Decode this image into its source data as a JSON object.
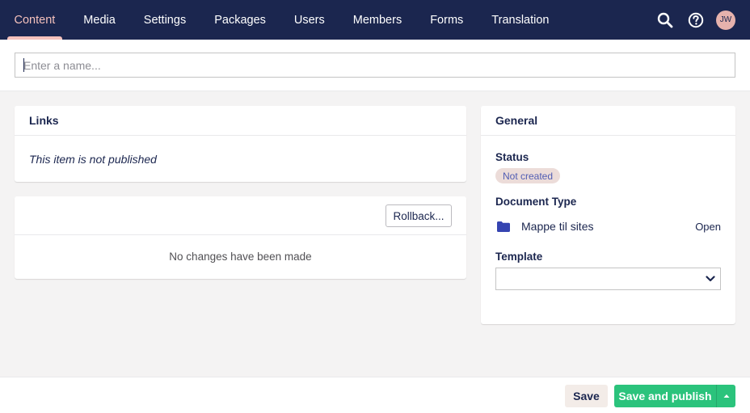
{
  "nav": {
    "items": [
      {
        "label": "Content",
        "active": true
      },
      {
        "label": "Media"
      },
      {
        "label": "Settings"
      },
      {
        "label": "Packages"
      },
      {
        "label": "Users"
      },
      {
        "label": "Members"
      },
      {
        "label": "Forms"
      },
      {
        "label": "Translation"
      }
    ],
    "icons": [
      "search-icon",
      "help-icon"
    ],
    "avatar_initials": "JW"
  },
  "name_field": {
    "placeholder": "Enter a name...",
    "value": ""
  },
  "links_panel": {
    "title": "Links",
    "message": "This item is not published"
  },
  "history_panel": {
    "rollback_label": "Rollback...",
    "message": "No changes have been made"
  },
  "general_panel": {
    "title": "General",
    "status_label": "Status",
    "status_value": "Not created",
    "doc_type_label": "Document Type",
    "doc_type_icon": "folder-icon",
    "doc_type_name": "Mappe til sites",
    "open_label": "Open",
    "template_label": "Template",
    "template_value": ""
  },
  "footer": {
    "save_label": "Save",
    "publish_label": "Save and publish"
  },
  "colors": {
    "topbar": "#1b264f",
    "active_nav": "#f5c1bc",
    "publish": "#2bc37c",
    "background": "#f4f3f3"
  }
}
